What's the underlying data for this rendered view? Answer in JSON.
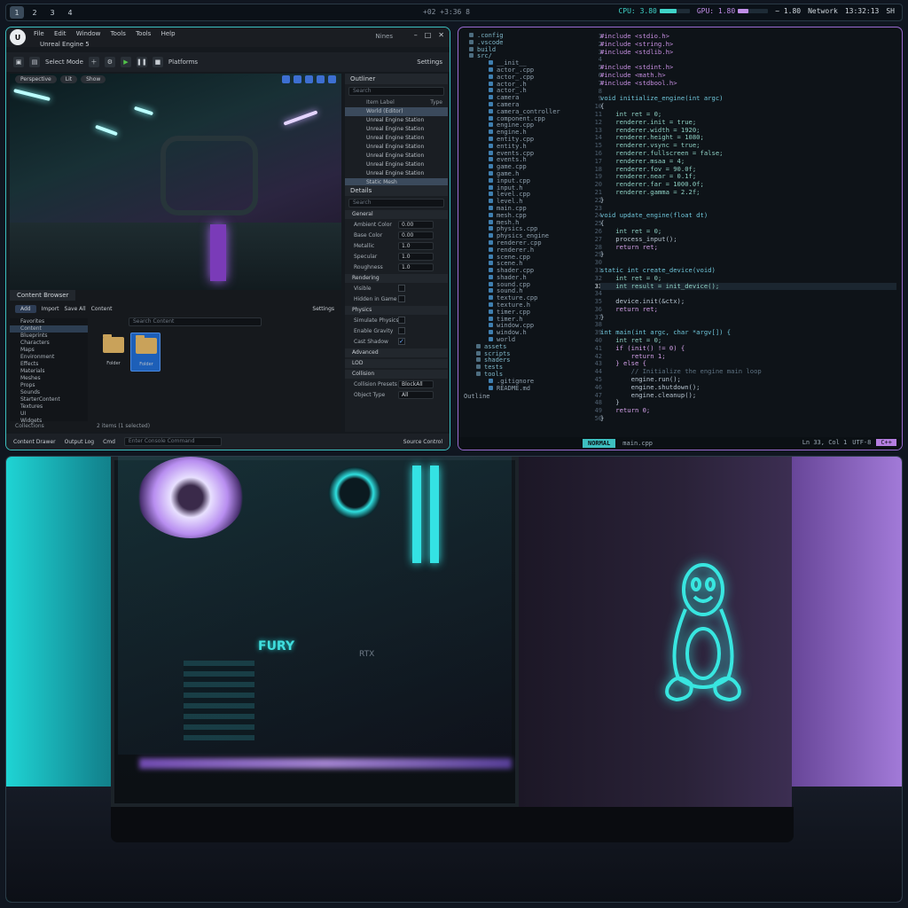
{
  "topbar": {
    "workspaces": [
      "1",
      "2",
      "3",
      "4"
    ],
    "center": "+02 +3:36 8",
    "cpu_label": "CPU: 3.80",
    "cpu_level": 0.55,
    "gpu_label": "GPU: 1.80",
    "gpu_level": 0.35,
    "mem_label": "~ 1.80",
    "net_label": "Network",
    "clock": "13:32:13",
    "session": "SH"
  },
  "ue": {
    "menu": [
      "File",
      "Edit",
      "Window",
      "Tools",
      "Tools",
      "Help"
    ],
    "tab": "Unreal Engine 5",
    "project": "Nines",
    "toolbar": {
      "mode": "Select Mode",
      "platforms": "Platforms",
      "settings": "Settings"
    },
    "viewport": {
      "perspective": "Perspective",
      "lit": "Lit",
      "show": "Show"
    },
    "outliner": {
      "title": "Outliner",
      "search": "Search",
      "col_label": "Item Label",
      "col_type": "Type",
      "rows": [
        "World (Editor)",
        "Unreal Engine Station",
        "Unreal Engine Station",
        "Unreal Engine Station",
        "Unreal Engine Station",
        "Unreal Engine Station",
        "Unreal Engine Station",
        "Unreal Engine Station",
        "Static Mesh"
      ]
    },
    "details": {
      "title": "Details",
      "search": "Search",
      "section_general": "General",
      "props": [
        {
          "k": "Ambient Color",
          "v": "0.00"
        },
        {
          "k": "Base Color",
          "v": "0.00"
        },
        {
          "k": "Metallic",
          "v": "1.0"
        },
        {
          "k": "Specular",
          "v": "1.0"
        },
        {
          "k": "Roughness",
          "v": "1.0"
        }
      ],
      "section_rendering": "Rendering",
      "r_props": [
        "Visible",
        "Hidden in Game"
      ],
      "section_physics": "Physics",
      "p_props": [
        "Simulate Physics",
        "Enable Gravity",
        "Cast Shadow"
      ],
      "section_advanced": "Advanced",
      "section_lod": "LOD",
      "section_collision": "Collision",
      "c_props": [
        {
          "k": "Collision Presets",
          "v": "BlockAll"
        },
        {
          "k": "Object Type",
          "v": "All"
        }
      ]
    },
    "content_browser": {
      "tab": "Content Browser",
      "add": "Add",
      "import": "Import",
      "save": "Save All",
      "path": "Content",
      "settings": "Settings",
      "search": "Search Content",
      "tree": [
        "Favorites",
        "Content",
        "Blueprints",
        "Characters",
        "Maps",
        "Environment",
        "Effects",
        "Materials",
        "Meshes",
        "Props",
        "Sounds",
        "StarterContent",
        "Textures",
        "UI",
        "Widgets"
      ],
      "folders": [
        "Folder",
        "Folder"
      ],
      "count": "2 items (1 selected)",
      "collections": "Collections"
    },
    "status": {
      "content_drawer": "Content Drawer",
      "output_log": "Output Log",
      "cmd": "Cmd",
      "cmd_placeholder": "Enter Console Command",
      "source_control": "Source Control"
    }
  },
  "ide": {
    "tree": [
      {
        "t": ".config",
        "dir": true
      },
      {
        "t": ".vscode",
        "dir": true
      },
      {
        "t": "build",
        "dir": true
      },
      {
        "t": "src/",
        "dir": true
      },
      {
        "t": "__init__",
        "dir": false
      },
      {
        "t": "actor_.cpp",
        "dir": false
      },
      {
        "t": "actor_.cpp",
        "dir": false
      },
      {
        "t": "actor_.h",
        "dir": false
      },
      {
        "t": "actor_.h",
        "dir": false
      },
      {
        "t": "camera",
        "dir": false
      },
      {
        "t": "camera",
        "dir": false
      },
      {
        "t": "camera_controller",
        "dir": false
      },
      {
        "t": "component.cpp",
        "dir": false
      },
      {
        "t": "engine.cpp",
        "dir": false
      },
      {
        "t": "engine.h",
        "dir": false
      },
      {
        "t": "entity.cpp",
        "dir": false
      },
      {
        "t": "entity.h",
        "dir": false
      },
      {
        "t": "events.cpp",
        "dir": false
      },
      {
        "t": "events.h",
        "dir": false
      },
      {
        "t": "game.cpp",
        "dir": false
      },
      {
        "t": "game.h",
        "dir": false
      },
      {
        "t": "input.cpp",
        "dir": false
      },
      {
        "t": "input.h",
        "dir": false
      },
      {
        "t": "level.cpp",
        "dir": false
      },
      {
        "t": "level.h",
        "dir": false
      },
      {
        "t": "main.cpp",
        "dir": false
      },
      {
        "t": "mesh.cpp",
        "dir": false
      },
      {
        "t": "mesh.h",
        "dir": false
      },
      {
        "t": "physics.cpp",
        "dir": false
      },
      {
        "t": "physics_engine",
        "dir": false
      },
      {
        "t": "renderer.cpp",
        "dir": false
      },
      {
        "t": "renderer.h",
        "dir": false
      },
      {
        "t": "scene.cpp",
        "dir": false
      },
      {
        "t": "scene.h",
        "dir": false
      },
      {
        "t": "shader.cpp",
        "dir": false
      },
      {
        "t": "shader.h",
        "dir": false
      },
      {
        "t": "sound.cpp",
        "dir": false
      },
      {
        "t": "sound.h",
        "dir": false
      },
      {
        "t": "texture.cpp",
        "dir": false
      },
      {
        "t": "texture.h",
        "dir": false
      },
      {
        "t": "timer.cpp",
        "dir": false
      },
      {
        "t": "timer.h",
        "dir": false
      },
      {
        "t": "window.cpp",
        "dir": false
      },
      {
        "t": "window.h",
        "dir": false
      },
      {
        "t": "world",
        "dir": false
      },
      {
        "t": "assets",
        "dir": true
      },
      {
        "t": "scripts",
        "dir": true
      },
      {
        "t": "shaders",
        "dir": true
      },
      {
        "t": "tests",
        "dir": true
      },
      {
        "t": "tools",
        "dir": true
      },
      {
        "t": ".gitignore",
        "dir": false
      },
      {
        "t": "README.md",
        "dir": false
      }
    ],
    "outline": "Outline",
    "lines": [
      "1",
      "2",
      "3",
      "4",
      "5",
      "6",
      "7",
      "8",
      "9",
      "10",
      "11",
      "12",
      "13",
      "14",
      "15",
      "16",
      "17",
      "18",
      "19",
      "20",
      "21",
      "22",
      "23",
      "24",
      "25",
      "26",
      "27",
      "28",
      "29",
      "30",
      "31",
      "32",
      "33",
      "34",
      "35",
      "36",
      "37",
      "38",
      "39",
      "40",
      "41",
      "42",
      "43",
      "44",
      "45",
      "46",
      "47",
      "48",
      "49",
      "50"
    ],
    "code": [
      "#include <stdio.h>",
      "#include <string.h>",
      "#include <stdlib.h>",
      "",
      "#include <stdint.h>",
      "#include <math.h>",
      "#include <stdbool.h>",
      "",
      "void initialize_engine(int argc)",
      "{",
      "    int ret = 0;",
      "    renderer.init = true;",
      "    renderer.width = 1920;",
      "    renderer.height = 1080;",
      "    renderer.vsync = true;",
      "    renderer.fullscreen = false;",
      "    renderer.msaa = 4;",
      "    renderer.fov = 90.0f;",
      "    renderer.near = 0.1f;",
      "    renderer.far = 1000.0f;",
      "    renderer.gamma = 2.2f;",
      "}",
      "",
      "void update_engine(float dt)",
      "{",
      "    int ret = 0;",
      "    process_input();",
      "    return ret;",
      "}",
      "",
      "static int create_device(void)",
      "    int ret = 0;",
      "    int result = init_device();",
      "",
      "    device.init(&ctx);",
      "    return ret;",
      "}",
      "",
      "int main(int argc, char *argv[]) {",
      "    int ret = 0;",
      "    if (init() != 0) {",
      "        return 1;",
      "    } else {",
      "        // Initialize the engine main loop",
      "        engine.run();",
      "        engine.shutdown();",
      "        engine.cleanup();",
      "    }",
      "    return 0;",
      "}"
    ],
    "status": {
      "mode": "NORMAL",
      "file": "main.cpp",
      "pos": "Ln 33, Col 1",
      "enc": "UTF-8",
      "lang": "C++"
    }
  },
  "photo": {
    "ram_brand": "FURY",
    "gpu_label": "RTX",
    "tux_color": "#38e6e0"
  }
}
